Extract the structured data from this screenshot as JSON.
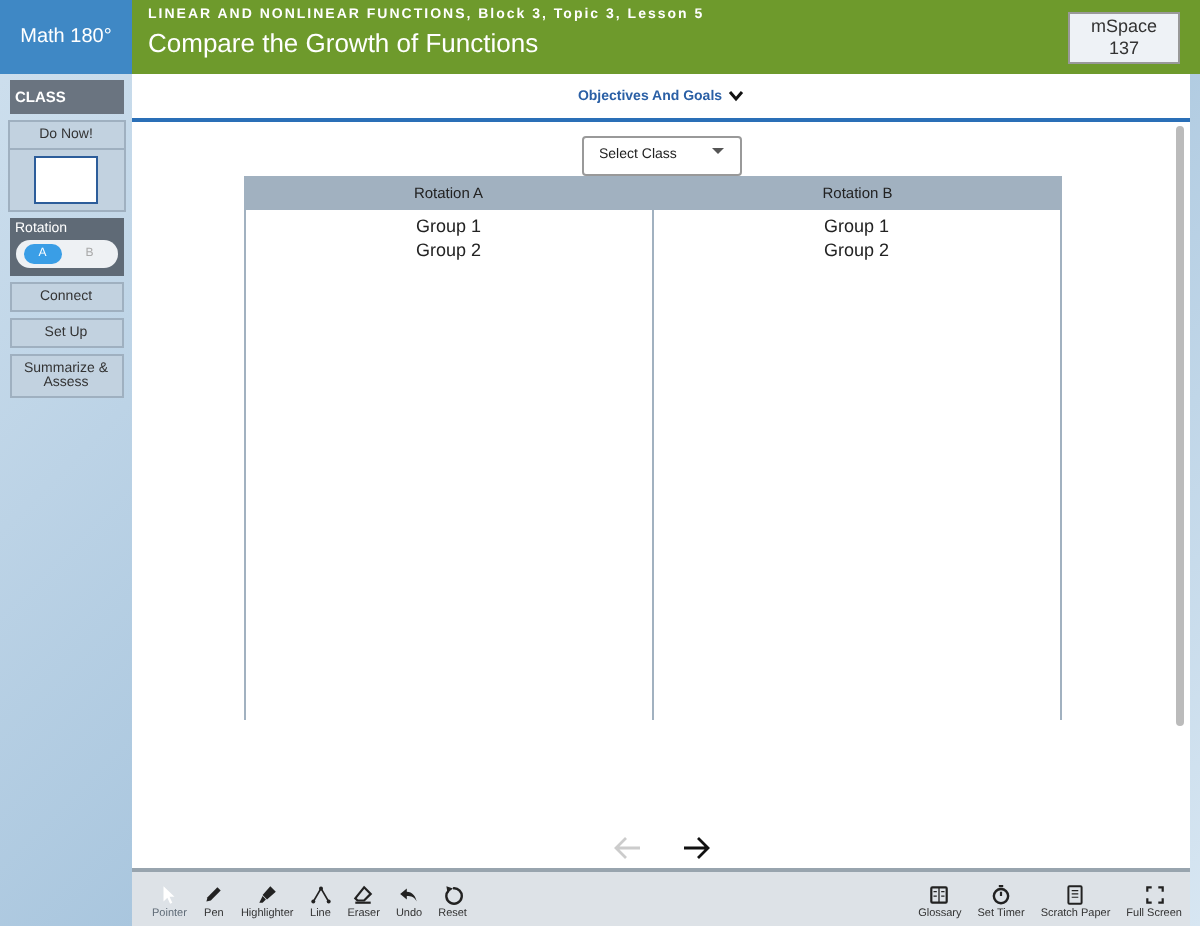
{
  "header": {
    "logo": "Math 180°",
    "breadcrumb": "LINEAR AND NONLINEAR FUNCTIONS, Block 3, Topic 3, Lesson 5",
    "title": "Compare the Growth of Functions",
    "mspace": {
      "label": "mSpace",
      "number": "137"
    }
  },
  "sidebar": {
    "class_label": "CLASS",
    "do_now": "Do Now!",
    "rotation": {
      "label": "Rotation",
      "options": [
        {
          "label": "A",
          "selected": true
        },
        {
          "label": "B",
          "selected": false
        }
      ]
    },
    "buttons": [
      "Connect",
      "Set Up",
      "Summarize & Assess"
    ]
  },
  "objectives": "Objectives And Goals",
  "select_class": {
    "placeholder": "Select Class"
  },
  "table": {
    "columns": [
      {
        "title": "Rotation A",
        "groups": [
          "Group 1",
          "Group 2"
        ]
      },
      {
        "title": "Rotation B",
        "groups": [
          "Group 1",
          "Group 2"
        ]
      }
    ]
  },
  "pager": {
    "prev_disabled": true,
    "next_disabled": false
  },
  "tools_left": [
    {
      "kind": "pointer",
      "label": "Pointer",
      "selected": true
    },
    {
      "kind": "pen",
      "label": "Pen",
      "selected": false
    },
    {
      "kind": "highlighter",
      "label": "Highlighter",
      "selected": false
    },
    {
      "kind": "line",
      "label": "Line",
      "selected": false
    },
    {
      "kind": "eraser",
      "label": "Eraser",
      "selected": false
    },
    {
      "kind": "undo",
      "label": "Undo",
      "selected": false
    },
    {
      "kind": "reset",
      "label": "Reset",
      "selected": false
    }
  ],
  "tools_right": [
    {
      "kind": "glossary",
      "label": "Glossary"
    },
    {
      "kind": "timer",
      "label": "Set Timer"
    },
    {
      "kind": "paper",
      "label": "Scratch Paper"
    },
    {
      "kind": "fullscreen",
      "label": "Full Screen"
    }
  ]
}
